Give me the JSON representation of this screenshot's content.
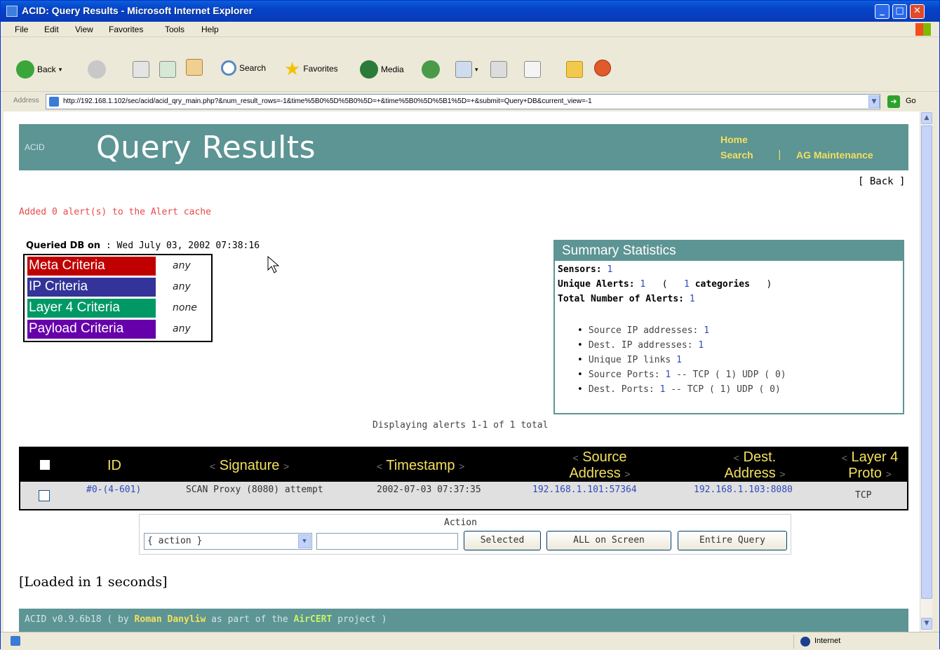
{
  "window": {
    "title": "ACID: Query Results - Microsoft Internet Explorer",
    "controls": {
      "minimize": "_",
      "maximize": "□",
      "close": "✕"
    }
  },
  "menu": [
    "File",
    "Edit",
    "View",
    "Favorites",
    "Tools",
    "Help"
  ],
  "toolbar": {
    "back": "Back",
    "search": "Search",
    "favorites": "Favorites",
    "media": "Media"
  },
  "address": {
    "label": "Address",
    "url": "http://192.168.1.102/sec/acid/acid_qry_main.php?&num_result_rows=-1&time%5B0%5D%5B0%5D=+&time%5B0%5D%5B1%5D=+&submit=Query+DB&current_view=-1",
    "go": "Go"
  },
  "header": {
    "brand": "ACID",
    "title": "Query Results",
    "links": {
      "home": "Home",
      "search": "Search",
      "sep": "|",
      "ag": "AG Maintenance"
    }
  },
  "back_link": "[ Back ]",
  "cache_message": "Added 0 alert(s) to the Alert cache",
  "queried": {
    "label": "Queried DB on",
    "value": ": Wed July 03, 2002 07:38:16"
  },
  "criteria": [
    {
      "label": "Meta Criteria",
      "value": "any",
      "color": "#c00000"
    },
    {
      "label": "IP Criteria",
      "value": "any",
      "color": "#333399"
    },
    {
      "label": "Layer 4 Criteria",
      "value": "none",
      "color": "#009966"
    },
    {
      "label": "Payload Criteria",
      "value": "any",
      "color": "#6600aa"
    }
  ],
  "summary": {
    "title": "Summary Statistics",
    "sensors_label": "Sensors:",
    "sensors_value": "1",
    "unique_label": "Unique Alerts:",
    "unique_value": "1",
    "categories_open": "(",
    "categories_value": "1",
    "categories_label": "categories",
    "categories_close": ")",
    "total_label": "Total Number of Alerts:",
    "total_value": "1",
    "list": [
      {
        "label": "Source IP addresses:",
        "value": "1"
      },
      {
        "label": "Dest. IP addresses:",
        "value": "1"
      },
      {
        "label": "Unique IP links",
        "value": "1"
      },
      {
        "label": "Source Ports:",
        "value": "1",
        "extra": "-- TCP ( 1) UDP ( 0)"
      },
      {
        "label": "Dest. Ports:",
        "value": "1",
        "extra": "-- TCP ( 1) UDP ( 0)"
      }
    ]
  },
  "displaying": "Displaying alerts 1-1 of 1 total",
  "results": {
    "columns": {
      "id": "ID",
      "signature": "Signature",
      "timestamp": "Timestamp",
      "source1": "Source",
      "source2": "Address",
      "dest1": "Dest.",
      "dest2": "Address",
      "proto1": "Layer 4",
      "proto2": "Proto",
      "lt": "<",
      "gt": ">"
    },
    "rows": [
      {
        "id": "#0-(4-601)",
        "signature": "SCAN Proxy (8080) attempt",
        "timestamp": "2002-07-03 07:37:35",
        "source": "192.168.1.101:57364",
        "dest": "192.168.1.103:8080",
        "proto": "TCP"
      }
    ]
  },
  "action": {
    "label": "Action",
    "select_value": "{ action }",
    "buttons": {
      "selected": "Selected",
      "all": "ALL on Screen",
      "entire": "Entire Query"
    }
  },
  "loaded": "[Loaded in 1 seconds]",
  "footer": {
    "prefix": "ACID v0.9.6b18 ( by",
    "author": "Roman Danyliw",
    "middle": "as part of the",
    "project": "AirCERT",
    "suffix": "project )"
  },
  "status": {
    "zone": "Internet"
  }
}
